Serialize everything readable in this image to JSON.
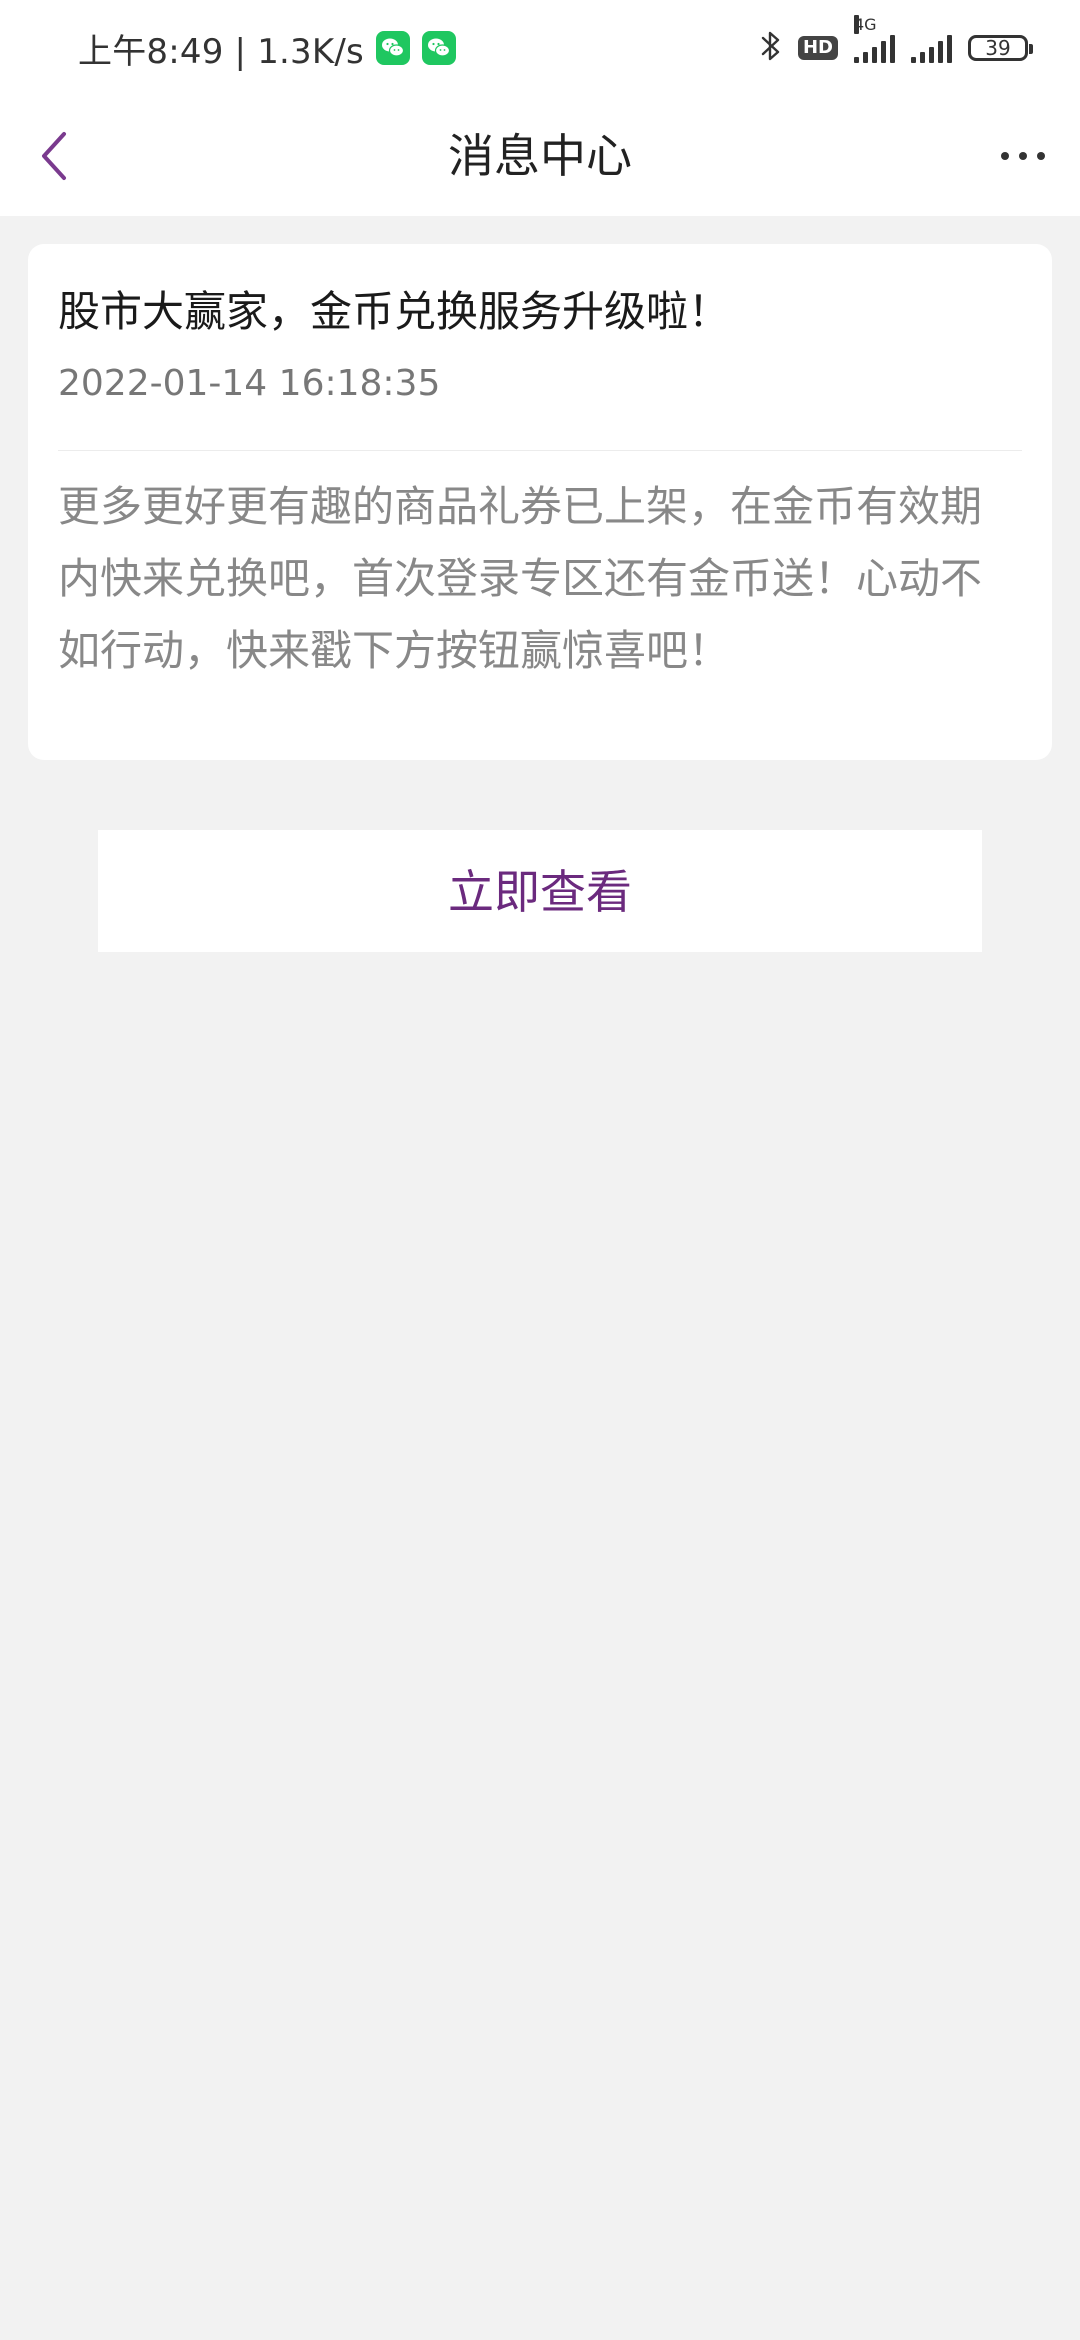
{
  "status_bar": {
    "time_speed": "上午8:49 | 1.3K/s",
    "network_label": "4G",
    "hd_label": "HD",
    "battery_level": "39"
  },
  "header": {
    "title": "消息中心"
  },
  "message": {
    "title": "股市大赢家，金币兑换服务升级啦！",
    "time": "2022-01-14 16:18:35",
    "body": "更多更好更有趣的商品礼券已上架，在金币有效期内快来兑换吧，首次登录专区还有金币送！心动不如行动，快来戳下方按钮赢惊喜吧！"
  },
  "action": {
    "view_label": "立即查看"
  },
  "colors": {
    "accent": "#6b2a7e",
    "background": "#f2f2f2",
    "wechat": "#1fc760"
  }
}
